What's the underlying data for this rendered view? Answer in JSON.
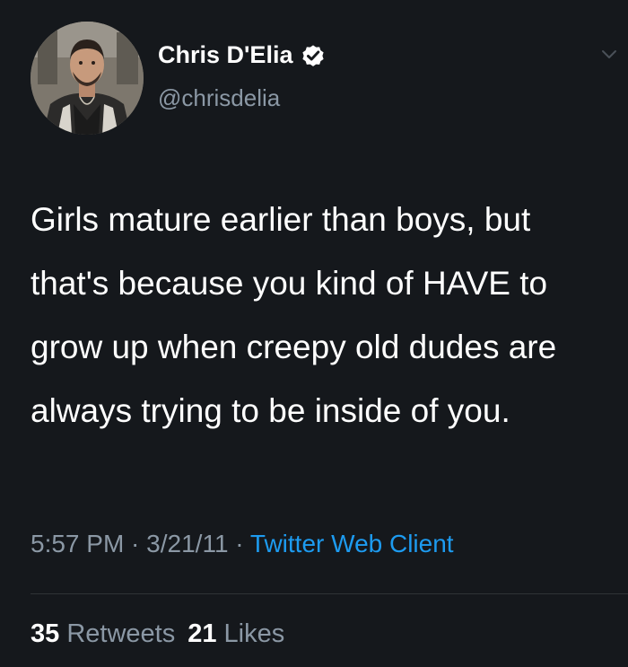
{
  "author": {
    "display_name": "Chris D'Elia",
    "handle": "@chrisdelia",
    "verified": true,
    "avatar": "profile-photo"
  },
  "tweet": {
    "text": "Girls mature earlier than boys, but that's because you kind of HAVE to grow up when creepy old dudes are always trying to be inside of you."
  },
  "meta": {
    "time": "5:57 PM",
    "separator1": " · ",
    "date": "3/21/11",
    "separator2": " · ",
    "client": "Twitter Web Client"
  },
  "stats": {
    "retweets_count": "35",
    "retweets_label": "Retweets",
    "likes_count": "21",
    "likes_label": "Likes"
  },
  "icons": {
    "verified": "verified-badge-icon",
    "menu": "chevron-down-icon"
  },
  "colors": {
    "background": "#15181c",
    "text": "#ffffff",
    "secondary": "#8b98a5",
    "link": "#1d9bf0",
    "divider": "#2f3336"
  }
}
